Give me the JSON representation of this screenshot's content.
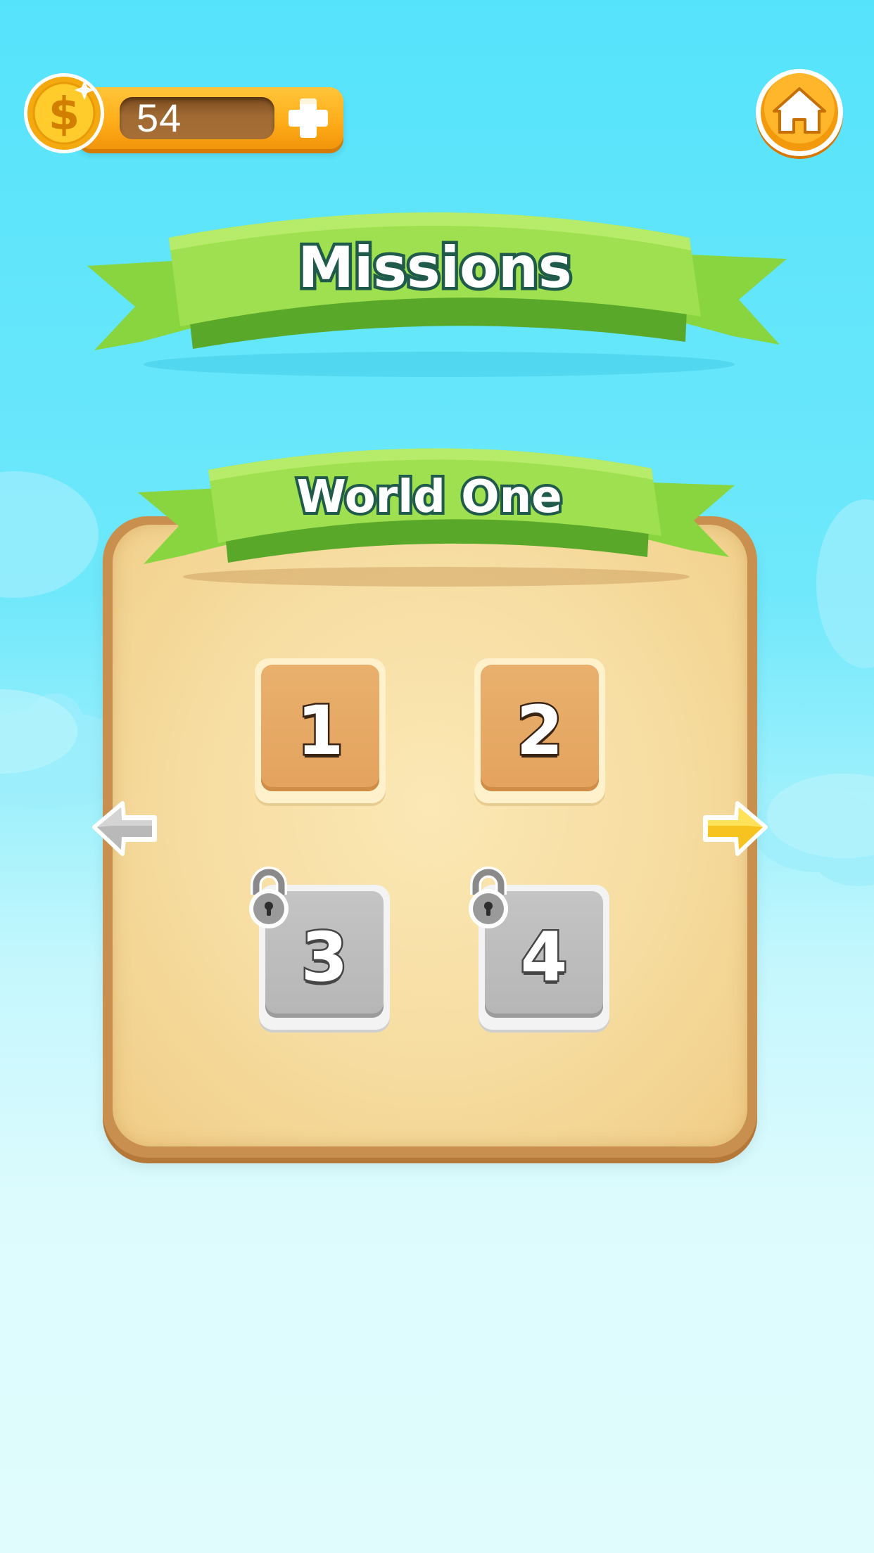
{
  "header": {
    "coins": "54",
    "coin_icon": "dollar-coin-icon",
    "add_icon": "plus-icon",
    "home_icon": "home-icon"
  },
  "title_banner": {
    "text": "Missions"
  },
  "world_panel": {
    "title": "World One",
    "prev_icon": "arrow-left-icon",
    "next_icon": "arrow-right-icon",
    "levels": [
      {
        "number": "1",
        "locked": false
      },
      {
        "number": "2",
        "locked": false
      },
      {
        "number": "3",
        "locked": true
      },
      {
        "number": "4",
        "locked": true
      }
    ]
  },
  "colors": {
    "sky_top": "#55e3fb",
    "sky_bottom": "#e0fcfd",
    "ribbon_green": "#8fd944",
    "coin_gold": "#ffb81f",
    "panel_cream": "#f6dca0",
    "tile_orange": "#e3a35e",
    "tile_locked_gray": "#b6b6b6"
  }
}
